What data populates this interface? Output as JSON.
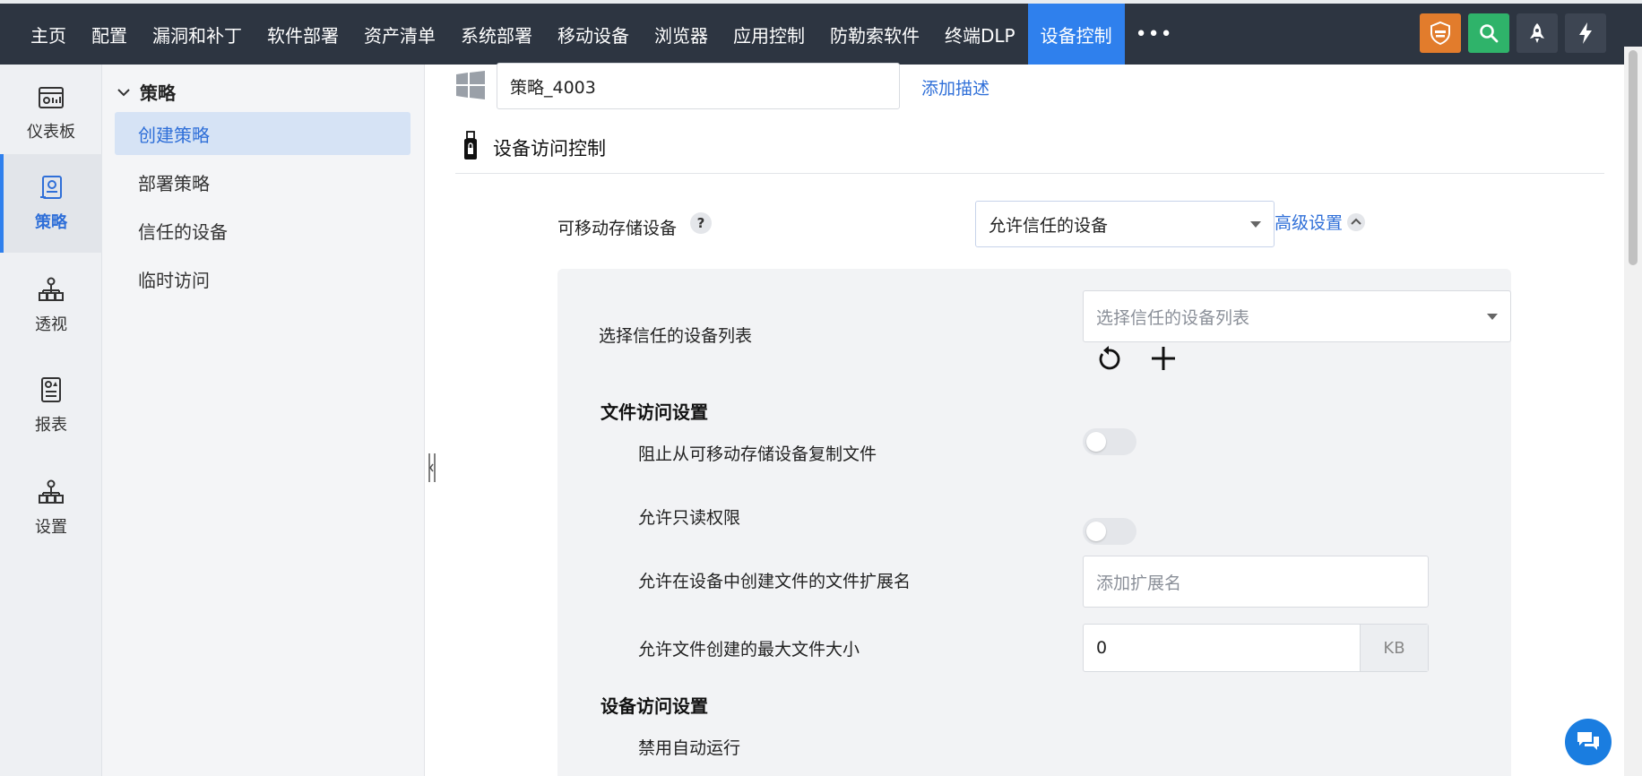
{
  "topnav": {
    "items": [
      "主页",
      "配置",
      "漏洞和补丁",
      "软件部署",
      "资产清单",
      "系统部署",
      "移动设备",
      "浏览器",
      "应用控制",
      "防勒索软件",
      "终端DLP",
      "设备控制"
    ],
    "more": "•••"
  },
  "rail": {
    "items": [
      {
        "label": "仪表板",
        "icon": "dashboard-icon"
      },
      {
        "label": "策略",
        "icon": "policy-icon"
      },
      {
        "label": "透视",
        "icon": "insight-icon"
      },
      {
        "label": "报表",
        "icon": "report-icon"
      },
      {
        "label": "设置",
        "icon": "settings-icon"
      }
    ]
  },
  "subside": {
    "group": "策略",
    "links": [
      "创建策略",
      "部署策略",
      "信任的设备",
      "临时访问"
    ]
  },
  "main": {
    "policy_name": "策略_4003",
    "add_description": "添加描述",
    "section_title": "设备访问控制",
    "removable_label": "可移动存储设备",
    "help": "?",
    "removable_value": "允许信任的设备",
    "advanced": "高级设置",
    "trusted_list_label": "选择信任的设备列表",
    "trusted_list_placeholder": "选择信任的设备列表",
    "file_access_title": "文件访问设置",
    "block_copy_label": "阻止从可移动存储设备复制文件",
    "readonly_label": "允许只读权限",
    "extension_label": "允许在设备中创建文件的文件扩展名",
    "extension_placeholder": "添加扩展名",
    "maxsize_label": "允许文件创建的最大文件大小",
    "maxsize_value": "0",
    "maxsize_unit": "KB",
    "device_access_title": "设备访问设置",
    "autorun_label": "禁用自动运行"
  },
  "toggles": {
    "block_copy": false,
    "readonly": false,
    "autorun": true
  },
  "colors": {
    "topnav_bg": "#2d3541",
    "active_blue": "#2f80ed",
    "link_blue": "#2f6fd8",
    "shield_orange": "#e27c2c",
    "search_green": "#2fb36a"
  }
}
